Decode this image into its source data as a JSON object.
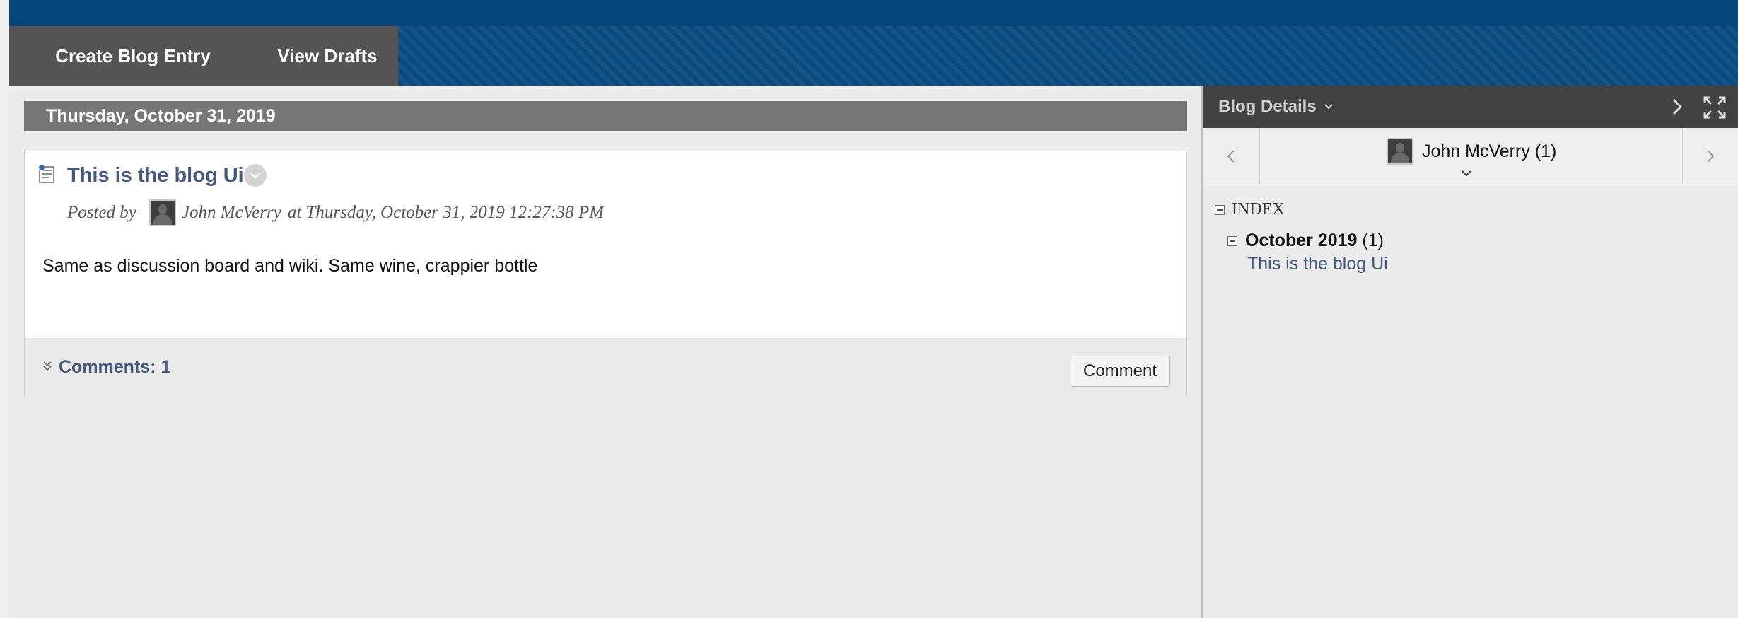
{
  "actions": {
    "create_entry": "Create Blog Entry",
    "view_drafts": "View Drafts"
  },
  "entry": {
    "date_header": "Thursday, October 31, 2019",
    "title": "This is the blog Ui",
    "posted_by_label": "Posted by",
    "author": "John McVerry",
    "posted_at": "at Thursday, October 31, 2019 12:27:38 PM",
    "body": "Same as discussion board and wiki. Same wine, crappier bottle",
    "comments_label": "Comments: 1",
    "comment_button": "Comment"
  },
  "sidebar": {
    "title": "Blog Details",
    "user_label": "John McVerry (1)",
    "index_label": "INDEX",
    "month": "October 2019",
    "month_count": "(1)",
    "entry_link": "This is the blog Ui"
  },
  "colors": {
    "top_bar": "#044679",
    "action_bar": "#0b4c80",
    "action_menu": "#545454",
    "date_header": "#777777",
    "link": "#45587c",
    "sidebar_header": "#424242"
  }
}
